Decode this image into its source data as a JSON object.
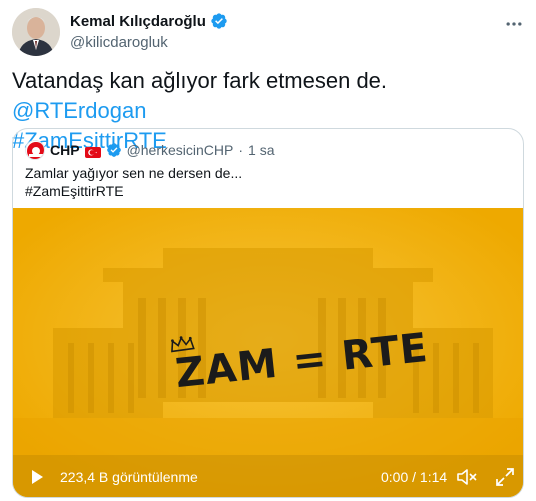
{
  "author": {
    "name": "Kemal Kılıçdaroğlu",
    "handle": "@kilicdarogluk"
  },
  "tweet": {
    "text": "Vatandaş kan ağlıyor fark etmesen de.",
    "mention": "@RTErdogan",
    "hashtag": "#ZamEşittirRTE"
  },
  "quoted": {
    "name": "CHP",
    "handle": "@herkesicinCHP",
    "separator": "·",
    "time": "1 sa",
    "text_line1": "Zamlar yağıyor sen ne dersen de...",
    "text_line2": "#ZamEşittirRTE"
  },
  "video": {
    "overlay_text": "ZAM = RTE",
    "views": "223,4 B görüntülenme",
    "duration": "0:00 / 1:14"
  },
  "colors": {
    "accent": "#1d9bf0",
    "video_bg": "#f3b100"
  },
  "icons": [
    "verified-badge-icon",
    "more-icon",
    "turkish-flag-icon",
    "play-icon",
    "volume-icon",
    "fullscreen-icon"
  ]
}
